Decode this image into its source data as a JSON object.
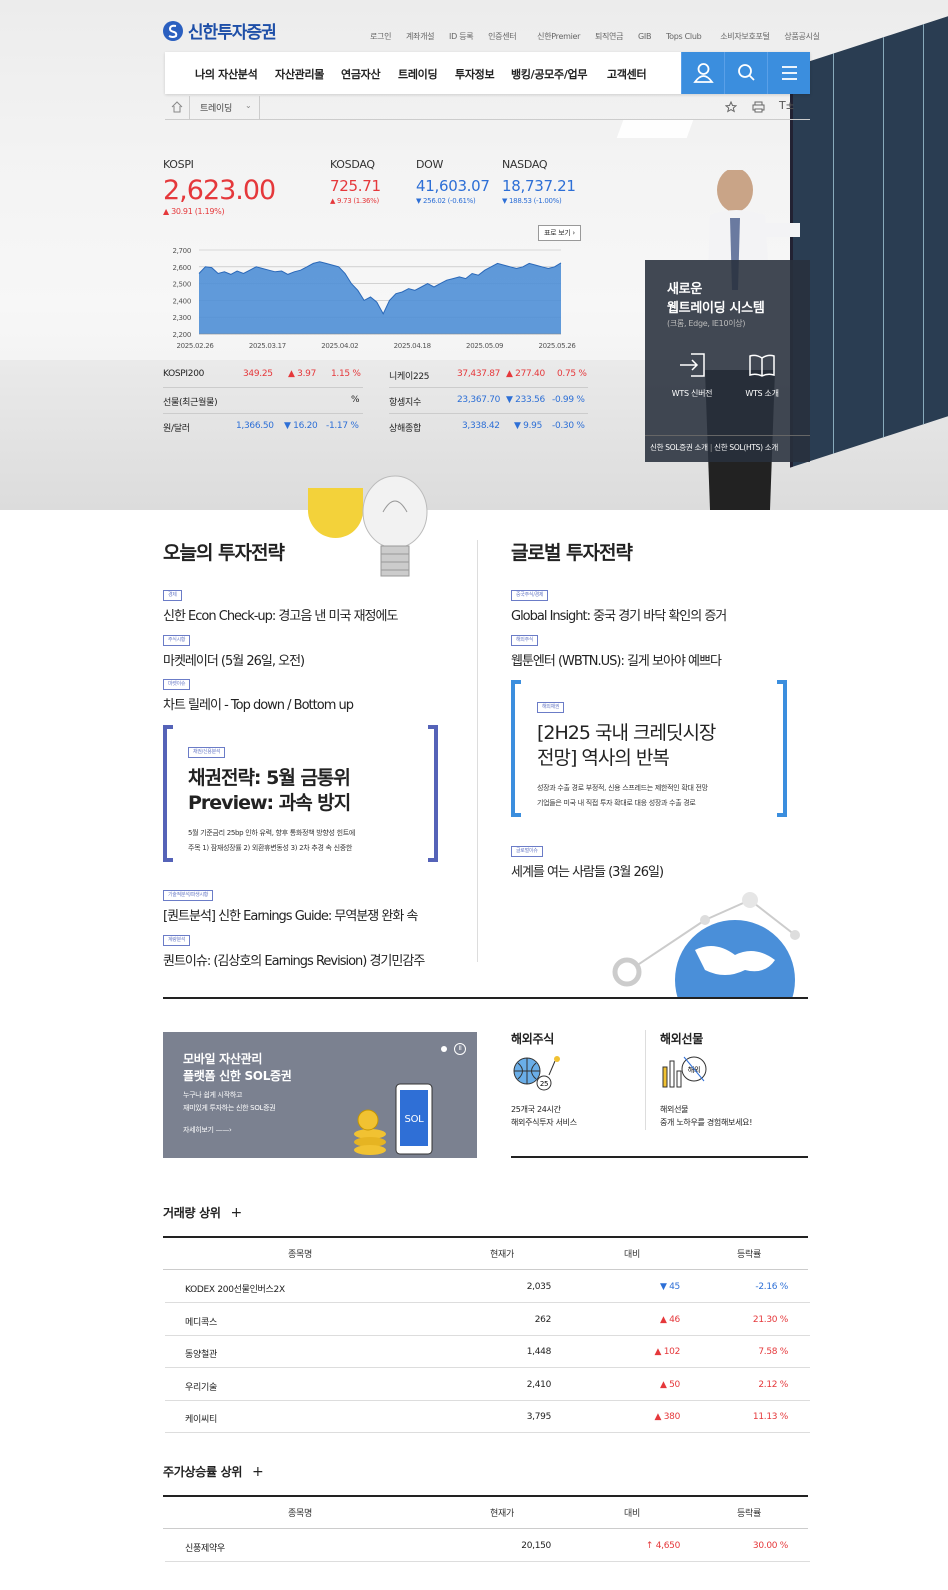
{
  "header": {
    "logo": "신한투자증권",
    "util_links": [
      "로그인",
      "계좌개설",
      "ID 등록",
      "인증센터",
      "신한Premier",
      "퇴직연금",
      "GIB",
      "Tops Club",
      "소비자보호포털",
      "상품공시실"
    ],
    "gnb": [
      "나의 자산분석",
      "자산관리몰",
      "연금자산",
      "트레이딩",
      "투자정보",
      "뱅킹/공모주/업무",
      "고객센터"
    ],
    "breadcrumb": "트레이딩"
  },
  "market": {
    "kospi": {
      "name": "KOSPI",
      "value": "2,623.00",
      "change": "▲ 30.91 (1.19%)"
    },
    "kosdaq": {
      "name": "KOSDAQ",
      "value": "725.71",
      "change": "▲ 9.73 (1.36%)"
    },
    "dow": {
      "name": "DOW",
      "value": "41,603.07",
      "change": "▼ 256.02 (-0.61%)"
    },
    "nasdaq": {
      "name": "NASDAQ",
      "value": "18,737.21",
      "change": "▼ 188.53 (-1.00%)"
    },
    "chart_toggle": "표로 보기"
  },
  "chart_data": {
    "type": "area",
    "y_ticks": [
      "2,700",
      "2,600",
      "2,500",
      "2,400",
      "2,300",
      "2,200"
    ],
    "x_ticks": [
      "2025.02.26",
      "2025.03.17",
      "2025.04.02",
      "2025.04.18",
      "2025.05.09",
      "2025.05.26"
    ],
    "ylim": [
      2200,
      2700
    ],
    "values": [
      2560,
      2600,
      2595,
      2560,
      2570,
      2555,
      2575,
      2560,
      2580,
      2600,
      2590,
      2580,
      2570,
      2575,
      2555,
      2570,
      2580,
      2600,
      2620,
      2630,
      2620,
      2610,
      2600,
      2560,
      2500,
      2460,
      2400,
      2420,
      2390,
      2320,
      2400,
      2440,
      2450,
      2470,
      2460,
      2480,
      2500,
      2480,
      2500,
      2520,
      2530,
      2540,
      2530,
      2560,
      2550,
      2580,
      2600,
      2620,
      2610,
      2600,
      2590,
      2600,
      2620,
      2610,
      2600,
      2590,
      2600,
      2623
    ],
    "color": "#4f8fd6"
  },
  "indices": [
    {
      "name": "KOSPI200",
      "value": "349.25",
      "change": "▲ 3.97",
      "rate": "1.15 %",
      "dir": "up"
    },
    {
      "name": "니케이225",
      "value": "37,437.87",
      "change": "▲ 277.40",
      "rate": "0.75 %",
      "dir": "up"
    },
    {
      "name": "선물(최근월물)",
      "value": "",
      "change": "",
      "rate": "%",
      "dir": "none"
    },
    {
      "name": "항셍지수",
      "value": "23,367.70",
      "change": "▼ 233.56",
      "rate": "-0.99 %",
      "dir": "down"
    },
    {
      "name": "원/달러",
      "value": "1,366.50",
      "change": "▼ 16.20",
      "rate": "-1.17 %",
      "dir": "down"
    },
    {
      "name": "상해종합",
      "value": "3,338.42",
      "change": "▼ 9.95",
      "rate": "-0.30 %",
      "dir": "down"
    }
  ],
  "wts_box": {
    "title1": "새로운",
    "title2": "웹트레이딩 시스템",
    "sub": "(크롬, Edge, IE10이상)",
    "btn1": "WTS 신버전",
    "btn2": "WTS 소개",
    "link1": "신한 SOL증권 소개",
    "link2": "신한 SOL(HTS) 소개"
  },
  "today_strategy": {
    "title": "오늘의 투자전략",
    "items": [
      {
        "tag": "경제",
        "text": "신한 Econ Check-up: 경고음 낸 미국 재정에도"
      },
      {
        "tag": "주식시황",
        "text": "마켓레이더 (5월 26일, 오전)"
      },
      {
        "tag": "마켓이슈",
        "text": "차트 릴레이 - Top down / Bottom up"
      }
    ],
    "feature": {
      "tag": "채권/신용분석",
      "title1": "채권전략: 5월 금통위",
      "title2": "Preview: 과속 방지",
      "desc1": "5월 기준금리 25bp 인하 유력, 향후 통화정책 방향성 힌트에",
      "desc2": "주목 1) 잠재성장률 2) 외환휴변동성 3) 2차 추경 속 신중한"
    },
    "items2": [
      {
        "tag": "기술적분석/파생시황",
        "text": "[퀀트분석] 신한 Earnings Guide: 무역분쟁 완화 속"
      },
      {
        "tag": "계량분석",
        "text": "퀀트이슈: (김상호의 Earnings Revision) 경기민감주"
      }
    ]
  },
  "global_strategy": {
    "title": "글로벌 투자전략",
    "items": [
      {
        "tag": "중국주식/경제",
        "text": "Global Insight: 중국 경기 바닥 확인의 증거"
      },
      {
        "tag": "해외주식",
        "text": "웹툰엔터 (WBTN.US): 길게 보아야 예쁘다"
      }
    ],
    "feature": {
      "tag": "해외채권",
      "title1": "[2H25 국내 크레딧시장",
      "title2": "전망] 역사의 반복",
      "desc1": "성장과 수출 경로 부정적, 신용 스프레드는 제한적인 확대 전망",
      "desc2": "기업들은 미국 내 직접 투자 확대로 대응 성장과 수출 경로"
    },
    "items2": [
      {
        "tag": "글로벌이슈",
        "text": "세계를 여는 사람들 (3월 26일)"
      }
    ]
  },
  "promo": {
    "title1": "모바일 자산관리",
    "title2": "플랫폼 신한 SOL증권",
    "desc1": "누구나 쉽게 시작하고",
    "desc2": "재미있게 투자하는 신한 SOL증권",
    "more": "자세히보기"
  },
  "overseas": [
    {
      "title": "해외주식",
      "desc1": "25개국 24시간",
      "desc2": "해외주식투자 서비스",
      "icon_text": "25"
    },
    {
      "title": "해외선물",
      "desc1": "해외선물",
      "desc2": "중개 노하우를 경험해보세요!",
      "icon_text": "해외"
    }
  ],
  "volume_top": {
    "title": "거래량 상위",
    "headers": [
      "종목명",
      "현재가",
      "대비",
      "등락률"
    ],
    "rows": [
      {
        "name": "KODEX 200선물인버스2X",
        "price": "2,035",
        "diff": "▼ 45",
        "rate": "-2.16 %",
        "dir": "down"
      },
      {
        "name": "메디콕스",
        "price": "262",
        "diff": "▲ 46",
        "rate": "21.30 %",
        "dir": "up"
      },
      {
        "name": "동양철관",
        "price": "1,448",
        "diff": "▲ 102",
        "rate": "7.58 %",
        "dir": "up"
      },
      {
        "name": "우리기술",
        "price": "2,410",
        "diff": "▲ 50",
        "rate": "2.12 %",
        "dir": "up"
      },
      {
        "name": "케이씨티",
        "price": "3,795",
        "diff": "▲ 380",
        "rate": "11.13 %",
        "dir": "up"
      }
    ]
  },
  "rise_top": {
    "title": "주가상승률 상위",
    "headers": [
      "종목명",
      "현재가",
      "대비",
      "등락률"
    ],
    "rows": [
      {
        "name": "신풍제약우",
        "price": "20,150",
        "diff": "↑ 4,650",
        "rate": "30.00 %",
        "dir": "up"
      }
    ]
  },
  "plus": "+"
}
